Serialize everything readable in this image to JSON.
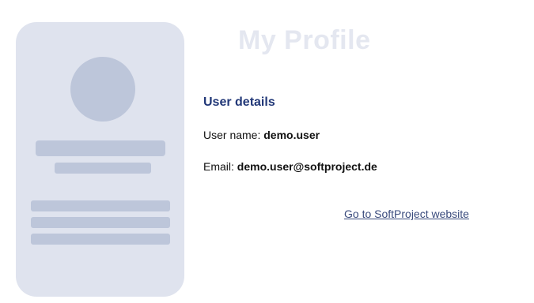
{
  "page": {
    "title": "My Profile"
  },
  "user_details": {
    "heading": "User details",
    "username_label": "User name:",
    "username_value": "demo.user",
    "email_label": "Email:",
    "email_value": "demo.user@softproject.de"
  },
  "link": {
    "label": "Go to SoftProject website"
  },
  "colors": {
    "card_background": "#dfe3ee",
    "placeholder": "#bdc6da",
    "title_text": "#e4e7f0",
    "heading": "#223878",
    "link": "#3a4b7d"
  }
}
